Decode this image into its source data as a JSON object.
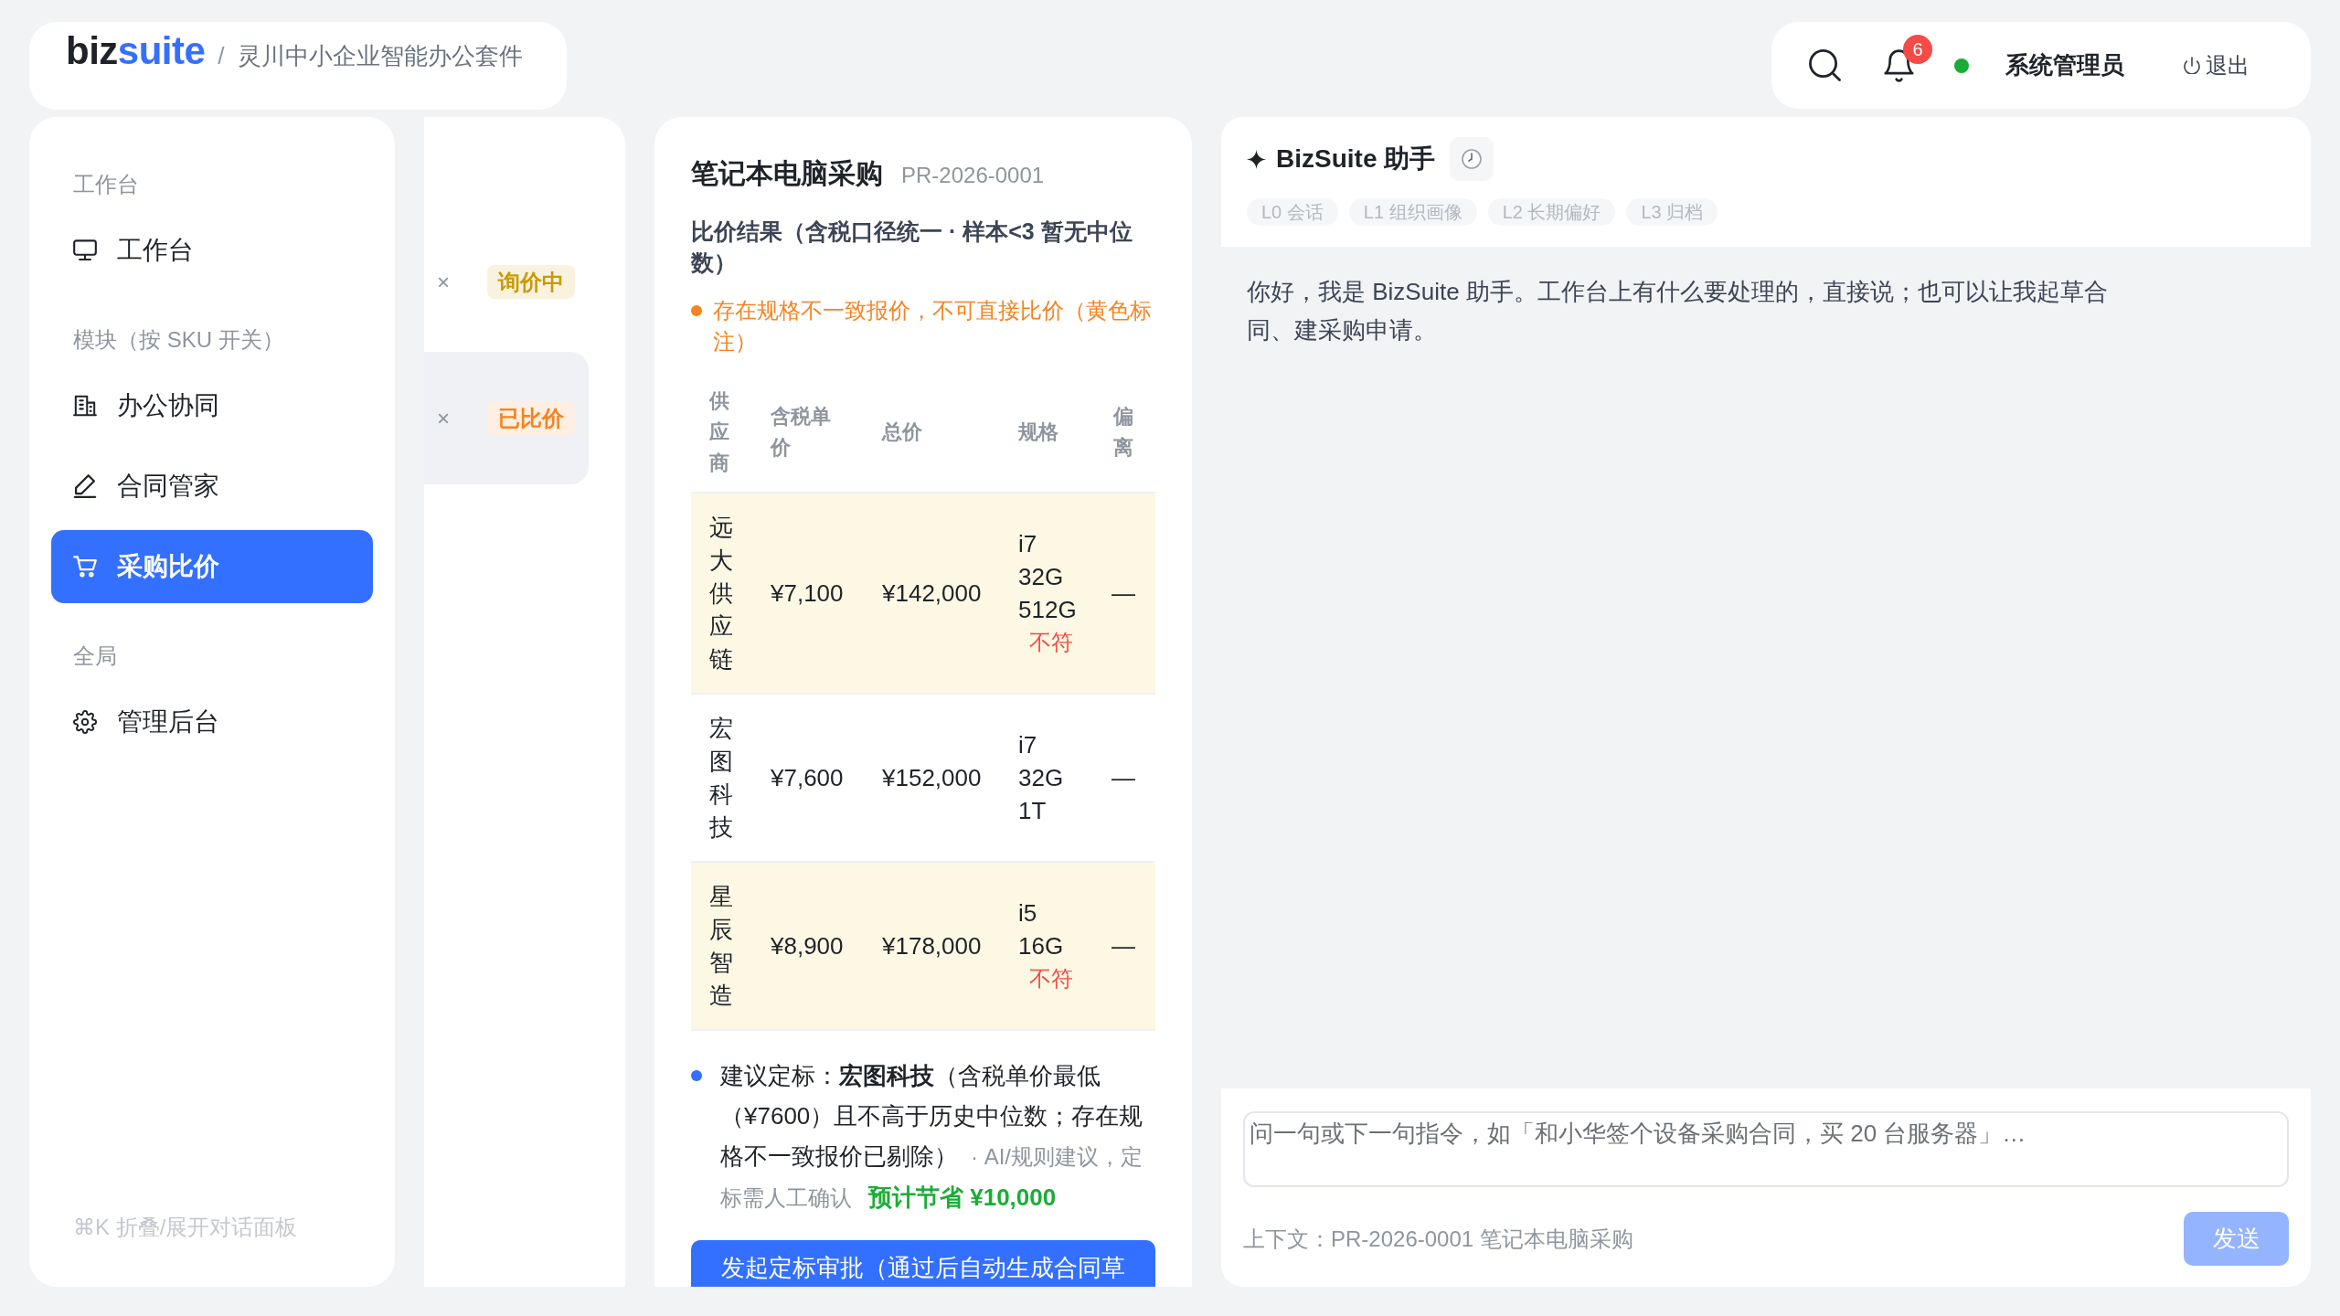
{
  "brand": {
    "logo": "biz",
    "logo_accent": "suite",
    "separator": "/",
    "product": "灵川中小企业智能办公套件"
  },
  "user_bar": {
    "notification_count": "6",
    "online": true,
    "user_name": "系统管理员",
    "logout": "退出"
  },
  "sidebar": {
    "sections": [
      {
        "title": "工作台",
        "items": [
          {
            "label": "工作台",
            "selected": false
          }
        ]
      },
      {
        "title": "模块（按 SKU 开关）",
        "items": [
          {
            "label": "办公协同",
            "selected": false
          },
          {
            "label": "合同管家",
            "selected": false
          },
          {
            "label": "采购比价",
            "selected": true
          }
        ]
      },
      {
        "title": "全局",
        "items": [
          {
            "label": "管理后台",
            "selected": false
          }
        ]
      }
    ],
    "footer_hint": "⌘K 折叠/展开对话面板"
  },
  "requests": [
    {
      "remove": "×",
      "status": "询价中",
      "color": "#c99a06",
      "selected": false
    },
    {
      "remove": "×",
      "status": "已比价",
      "color": "#f5831f",
      "selected": true
    }
  ],
  "detail": {
    "title": "笔记本电脑采购",
    "code": "PR-2026-0001",
    "subtitle": "比价结果（含税口径统一 · 样本<3 暂无中位数）",
    "warning": "存在规格不一致报价，不可直接比价（黄色标注）",
    "table": {
      "columns": [
        "供应商",
        "含税单价",
        "总价",
        "规格",
        "偏离"
      ],
      "rows": [
        {
          "supplier": "远大供应链",
          "unit_price": "¥7,100",
          "total": "¥142,000",
          "spec": "i7 32G 512G",
          "spec_flag": "不符",
          "deviation": "—",
          "highlighted": true
        },
        {
          "supplier": "宏图科技",
          "unit_price": "¥7,600",
          "total": "¥152,000",
          "spec": "i7 32G 1T",
          "deviation": "—",
          "highlighted": false
        },
        {
          "supplier": "星辰智造",
          "unit_price": "¥8,900",
          "total": "¥178,000",
          "spec": "i5 16G",
          "spec_flag": "不符",
          "deviation": "—",
          "highlighted": true
        }
      ]
    },
    "recommendation": {
      "text": "建议定标：**宏图科技**（含税单价最低（¥7600）且不高于历史中位数；存在规格不一致报价已剔除）",
      "note": "· AI/规则建议，定标需人工确认",
      "savings": "预计节省 ¥10,000"
    },
    "action_button": "发起定标审批（通过后自动生成合同草"
  },
  "assistant": {
    "title": "BizSuite 助手",
    "memory_layers": [
      "L0 会话",
      "L1 组织画像",
      "L2 长期偏好",
      "L3 归档"
    ],
    "messages": [
      {
        "text": "你好，我是 BizSuite 助手。工作台上有什么要处理的，直接说；也可以让我起草合同、建采购申请。"
      }
    ],
    "input": {
      "placeholder": "问一句或下一句指令，如「和小华签个设备采购合同，买 20 台服务器」…"
    },
    "context": "上下文：PR-2026-0001 笔记本电脑采购",
    "send_button": {
      "label": "发送",
      "disabled": true
    }
  }
}
